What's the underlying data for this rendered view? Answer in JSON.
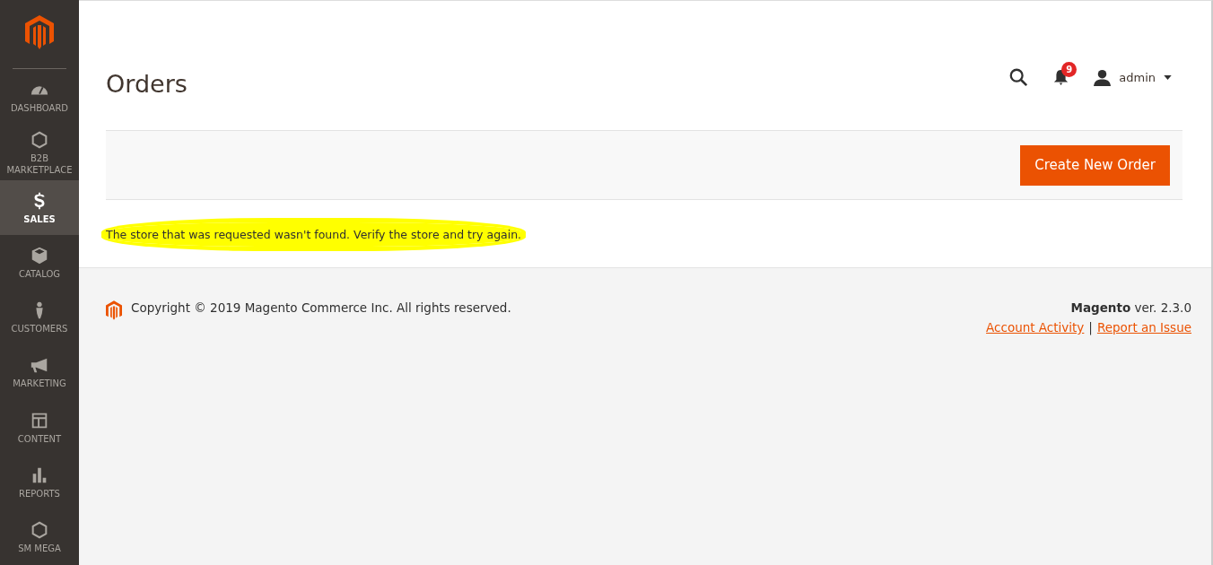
{
  "sidebar": {
    "items": [
      {
        "label": "DASHBOARD",
        "selected": false
      },
      {
        "label": "B2B MARKETPLACE",
        "selected": false
      },
      {
        "label": "SALES",
        "selected": true
      },
      {
        "label": "CATALOG",
        "selected": false
      },
      {
        "label": "CUSTOMERS",
        "selected": false
      },
      {
        "label": "MARKETING",
        "selected": false
      },
      {
        "label": "CONTENT",
        "selected": false
      },
      {
        "label": "REPORTS",
        "selected": false
      },
      {
        "label": "SM MEGA",
        "selected": false
      }
    ]
  },
  "header": {
    "title": "Orders",
    "notifications": "9",
    "user": "admin"
  },
  "toolbar": {
    "button": "Create New Order"
  },
  "message": "The store that was requested wasn't found. Verify the store and try again.",
  "footer": {
    "copyright": "Copyright © 2019 Magento Commerce Inc. All rights reserved.",
    "version": "**Magento** ver. 2.3.0",
    "links": [
      "Account Activity",
      "Report an Issue"
    ],
    "separator": "|"
  }
}
